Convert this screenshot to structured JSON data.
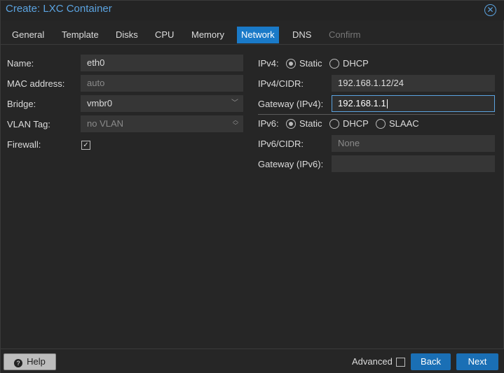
{
  "dialog": {
    "title": "Create: LXC Container",
    "close_icon": "close-circle-icon"
  },
  "tabs": [
    {
      "label": "General"
    },
    {
      "label": "Template"
    },
    {
      "label": "Disks"
    },
    {
      "label": "CPU"
    },
    {
      "label": "Memory"
    },
    {
      "label": "Network",
      "active": true
    },
    {
      "label": "DNS"
    },
    {
      "label": "Confirm",
      "disabled": true
    }
  ],
  "left": {
    "name": {
      "label": "Name:",
      "value": "eth0"
    },
    "mac": {
      "label": "MAC address:",
      "placeholder": "auto"
    },
    "bridge": {
      "label": "Bridge:",
      "value": "vmbr0"
    },
    "vlan": {
      "label": "VLAN Tag:",
      "placeholder": "no VLAN"
    },
    "firewall": {
      "label": "Firewall:",
      "checked": true
    }
  },
  "right": {
    "ipv4": {
      "label": "IPv4:",
      "options": [
        "Static",
        "DHCP"
      ],
      "selected": "Static"
    },
    "ipv4_cidr": {
      "label": "IPv4/CIDR:",
      "value": "192.168.1.12/24"
    },
    "gateway4": {
      "label": "Gateway (IPv4):",
      "value": "192.168.1.1"
    },
    "ipv6": {
      "label": "IPv6:",
      "options": [
        "Static",
        "DHCP",
        "SLAAC"
      ],
      "selected": "Static"
    },
    "ipv6_cidr": {
      "label": "IPv6/CIDR:",
      "placeholder": "None"
    },
    "gateway6": {
      "label": "Gateway (IPv6):",
      "value": ""
    }
  },
  "footer": {
    "help_label": "Help",
    "advanced_label": "Advanced",
    "advanced_checked": false,
    "back_label": "Back",
    "next_label": "Next"
  },
  "colors": {
    "accent": "#1a7ac8",
    "title": "#5ba3e0",
    "background": "#262626"
  }
}
